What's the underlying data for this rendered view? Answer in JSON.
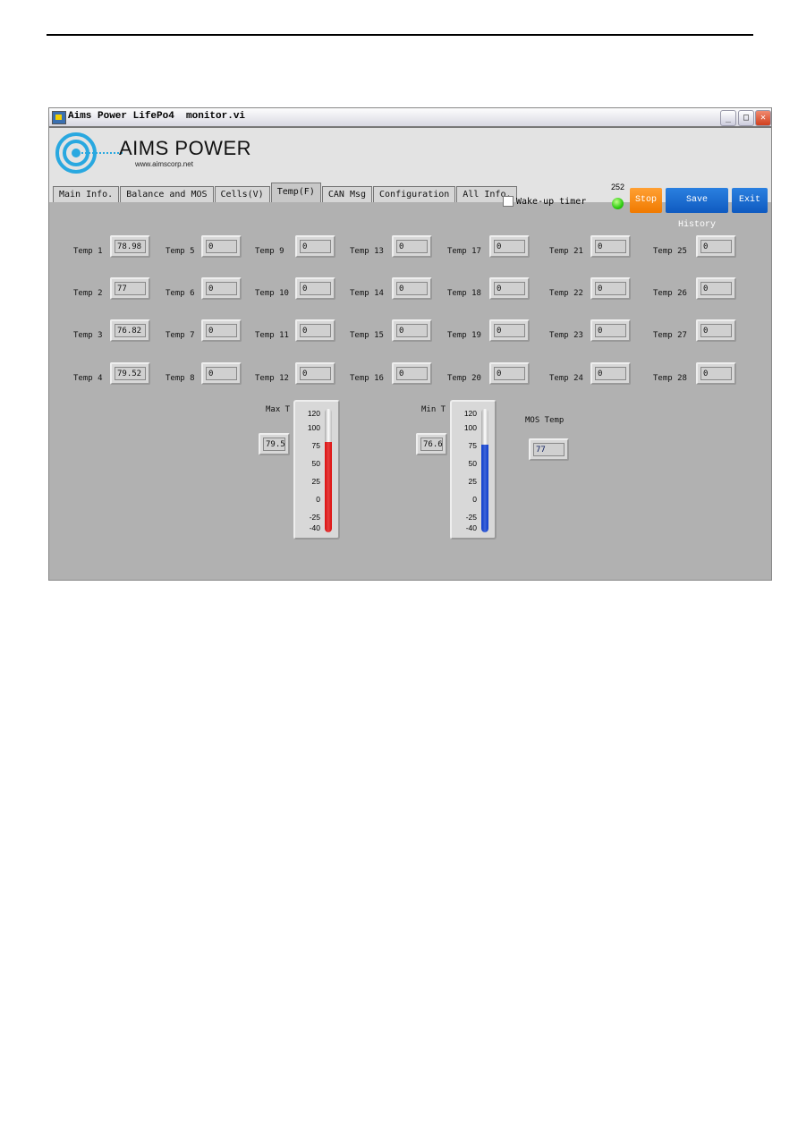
{
  "window": {
    "title": "Aims Power LifePo4  monitor.vi"
  },
  "logo": {
    "brand": "AIMS POWER",
    "url": "www.aimscorp.net"
  },
  "tabs": [
    {
      "label": "Main Info."
    },
    {
      "label": "Balance and MOS"
    },
    {
      "label": "Cells(V)"
    },
    {
      "label": "Temp(F)",
      "active": true
    },
    {
      "label": "CAN Msg"
    },
    {
      "label": "Configuration"
    },
    {
      "label": "All Info."
    }
  ],
  "controls": {
    "wakeup_label": "Wake-up timer",
    "wakeup_checked": false,
    "counter": "252",
    "led_color": "#2dcc10",
    "stop": "Stop",
    "save_history": "Save History",
    "exit": "Exit"
  },
  "temps": [
    {
      "label": "Temp 1",
      "value": "78.98"
    },
    {
      "label": "Temp 2",
      "value": "77"
    },
    {
      "label": "Temp 3",
      "value": "76.82"
    },
    {
      "label": "Temp 4",
      "value": "79.52"
    },
    {
      "label": "Temp 5",
      "value": "0"
    },
    {
      "label": "Temp 6",
      "value": "0"
    },
    {
      "label": "Temp 7",
      "value": "0"
    },
    {
      "label": "Temp 8",
      "value": "0"
    },
    {
      "label": "Temp 9",
      "value": "0"
    },
    {
      "label": "Temp 10",
      "value": "0"
    },
    {
      "label": "Temp 11",
      "value": "0"
    },
    {
      "label": "Temp 12",
      "value": "0"
    },
    {
      "label": "Temp 13",
      "value": "0"
    },
    {
      "label": "Temp 14",
      "value": "0"
    },
    {
      "label": "Temp 15",
      "value": "0"
    },
    {
      "label": "Temp 16",
      "value": "0"
    },
    {
      "label": "Temp 17",
      "value": "0"
    },
    {
      "label": "Temp 18",
      "value": "0"
    },
    {
      "label": "Temp 19",
      "value": "0"
    },
    {
      "label": "Temp 20",
      "value": "0"
    },
    {
      "label": "Temp 21",
      "value": "0"
    },
    {
      "label": "Temp 22",
      "value": "0"
    },
    {
      "label": "Temp 23",
      "value": "0"
    },
    {
      "label": "Temp 24",
      "value": "0"
    },
    {
      "label": "Temp 25",
      "value": "0"
    },
    {
      "label": "Temp 26",
      "value": "0"
    },
    {
      "label": "Temp 27",
      "value": "0"
    },
    {
      "label": "Temp 28",
      "value": "0"
    }
  ],
  "thermometers": [
    {
      "label": "Max T",
      "value": "79.5",
      "level": 79.5,
      "color": "#e01010"
    },
    {
      "label": "Min T",
      "value": "76.6",
      "level": 76.6,
      "color": "#1040d0"
    }
  ],
  "scale": {
    "min": -40,
    "max": 120,
    "ticks": [
      "120",
      "100",
      "75",
      "50",
      "25",
      "0",
      "-25",
      "-40"
    ]
  },
  "mos": {
    "label": "MOS Temp",
    "value": "77"
  }
}
